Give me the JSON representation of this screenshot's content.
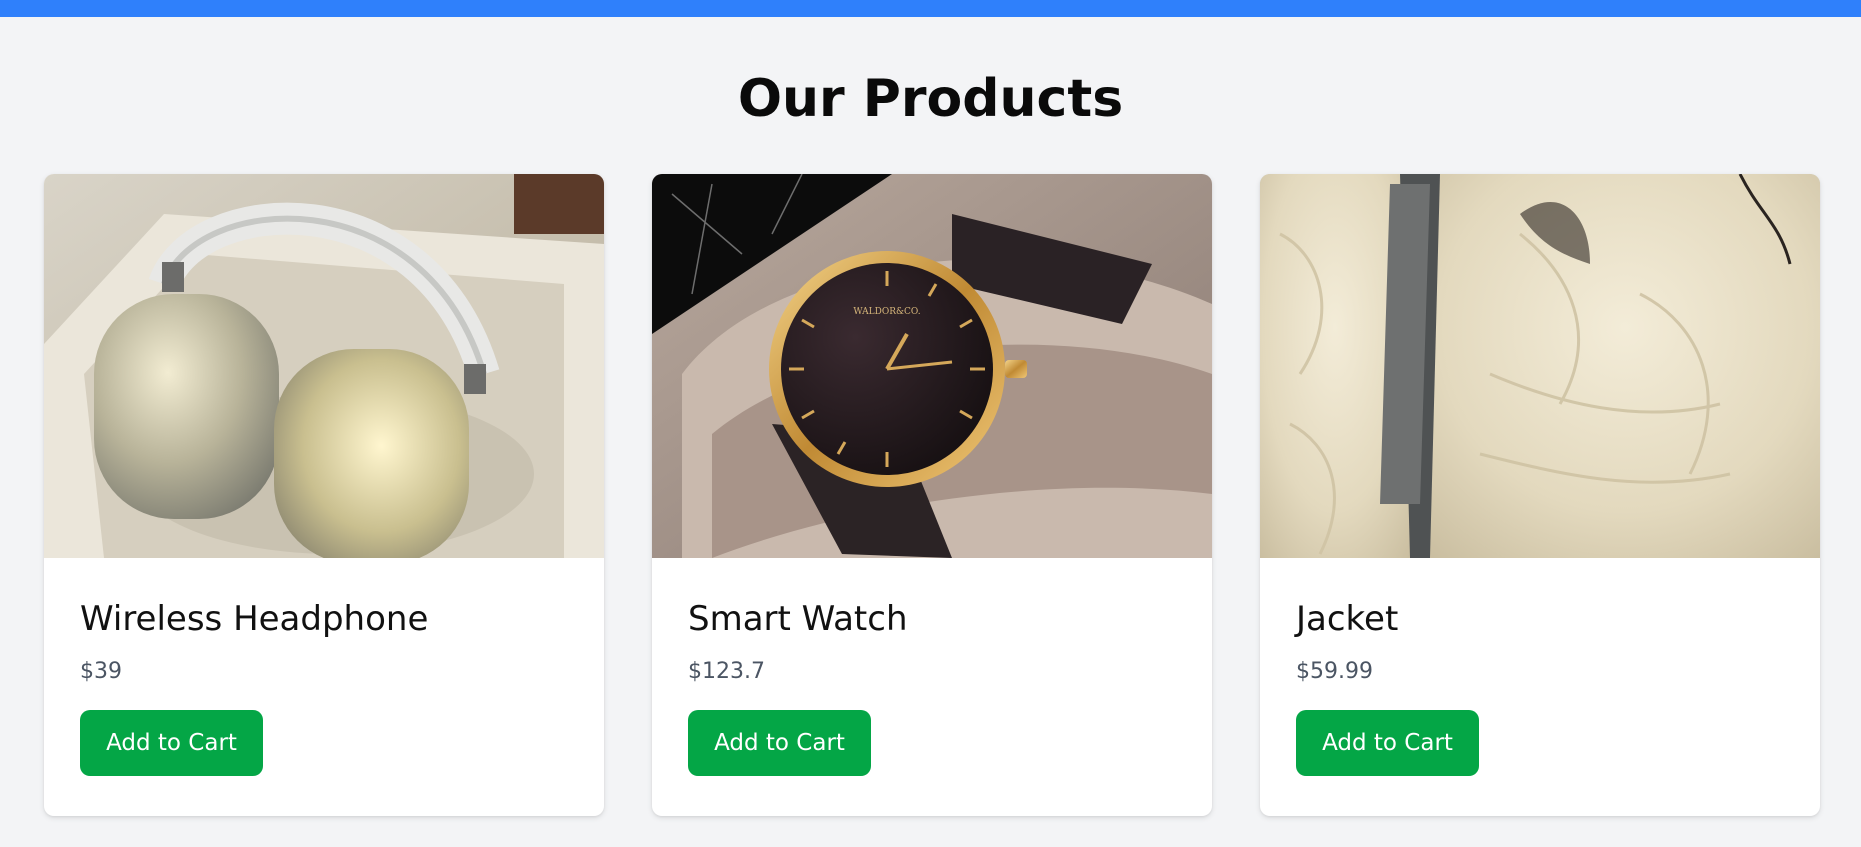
{
  "page": {
    "title": "Our Products",
    "accent_color": "#2f80fb",
    "button_color": "#04a646"
  },
  "products": [
    {
      "name": "Wireless Headphone",
      "price": "$39",
      "cta": "Add to Cart",
      "image": "headphone-photo"
    },
    {
      "name": "Smart Watch",
      "price": "$123.7",
      "cta": "Add to Cart",
      "image": "watch-photo",
      "watch_brand": "WALDOR&CO."
    },
    {
      "name": "Jacket",
      "price": "$59.99",
      "cta": "Add to Cart",
      "image": "jacket-photo"
    }
  ]
}
